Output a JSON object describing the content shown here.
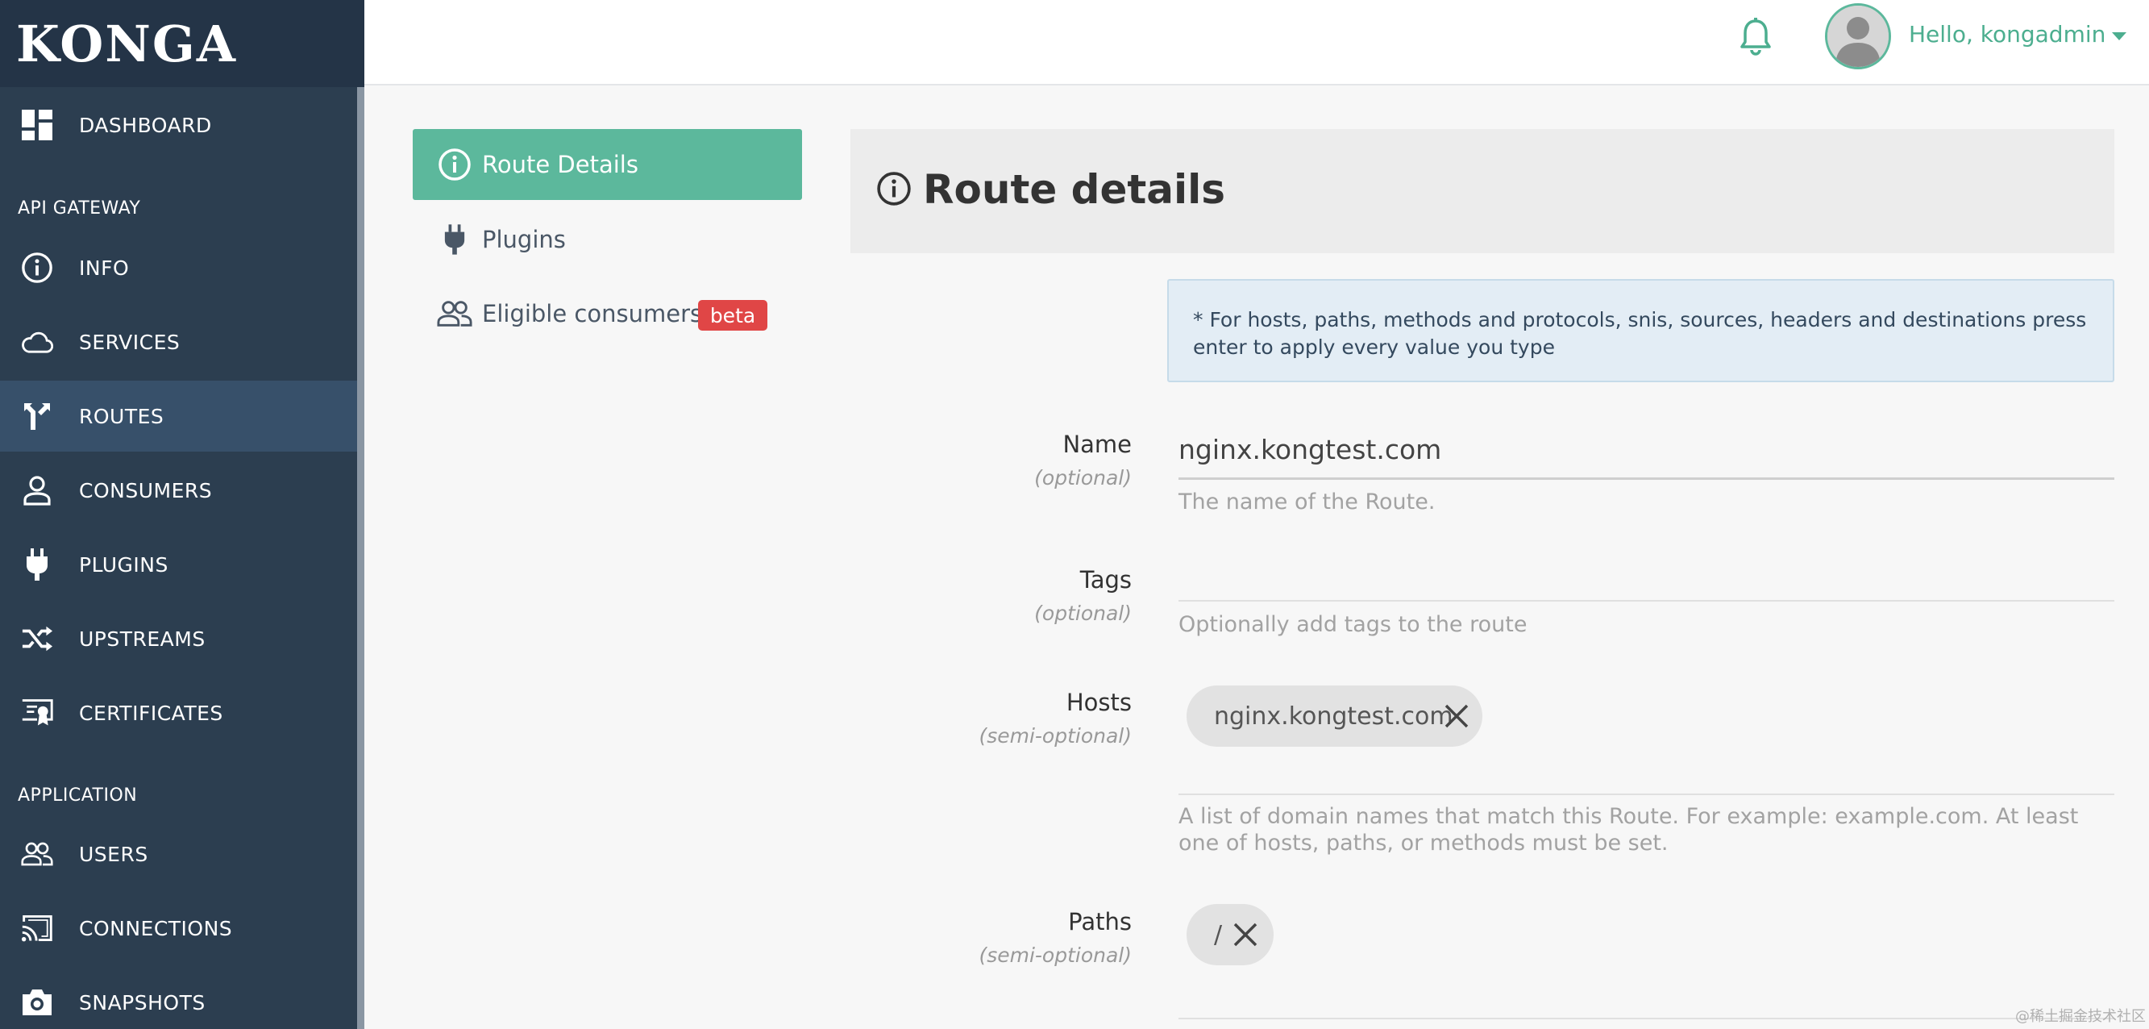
{
  "brand": "KONGA",
  "colors": {
    "sidebar": "#2c3e50",
    "accent": "#5cb89c",
    "badge": "#e04646"
  },
  "sidebar": {
    "dashboard": "DASHBOARD",
    "section_api": "API GATEWAY",
    "info": "INFO",
    "services": "SERVICES",
    "routes": "ROUTES",
    "consumers": "CONSUMERS",
    "plugins": "PLUGINS",
    "upstreams": "UPSTREAMS",
    "certificates": "CERTIFICATES",
    "section_app": "APPLICATION",
    "users": "USERS",
    "connections": "CONNECTIONS",
    "snapshots": "SNAPSHOTS"
  },
  "topbar": {
    "greeting": "Hello, kongadmin"
  },
  "tabs": {
    "route_details": "Route Details",
    "plugins": "Plugins",
    "eligible_consumers": "Eligible consumers",
    "beta": "beta"
  },
  "panel": {
    "title": "Route details",
    "alert": "* For hosts, paths, methods and protocols, snis, sources, headers and destinations press enter to apply every value you type"
  },
  "form": {
    "name": {
      "label": "Name",
      "hint": "(optional)",
      "value": "nginx.kongtest.com",
      "help": "The name of the Route."
    },
    "tags": {
      "label": "Tags",
      "hint": "(optional)",
      "help": "Optionally add tags to the route"
    },
    "hosts": {
      "label": "Hosts",
      "hint": "(semi-optional)",
      "chip": "nginx.kongtest.com",
      "help": "A list of domain names that match this Route. For example: example.com. At least one of hosts, paths, or methods must be set."
    },
    "paths": {
      "label": "Paths",
      "hint": "(semi-optional)",
      "chip": "/"
    }
  },
  "watermark": "@稀土掘金技术社区"
}
